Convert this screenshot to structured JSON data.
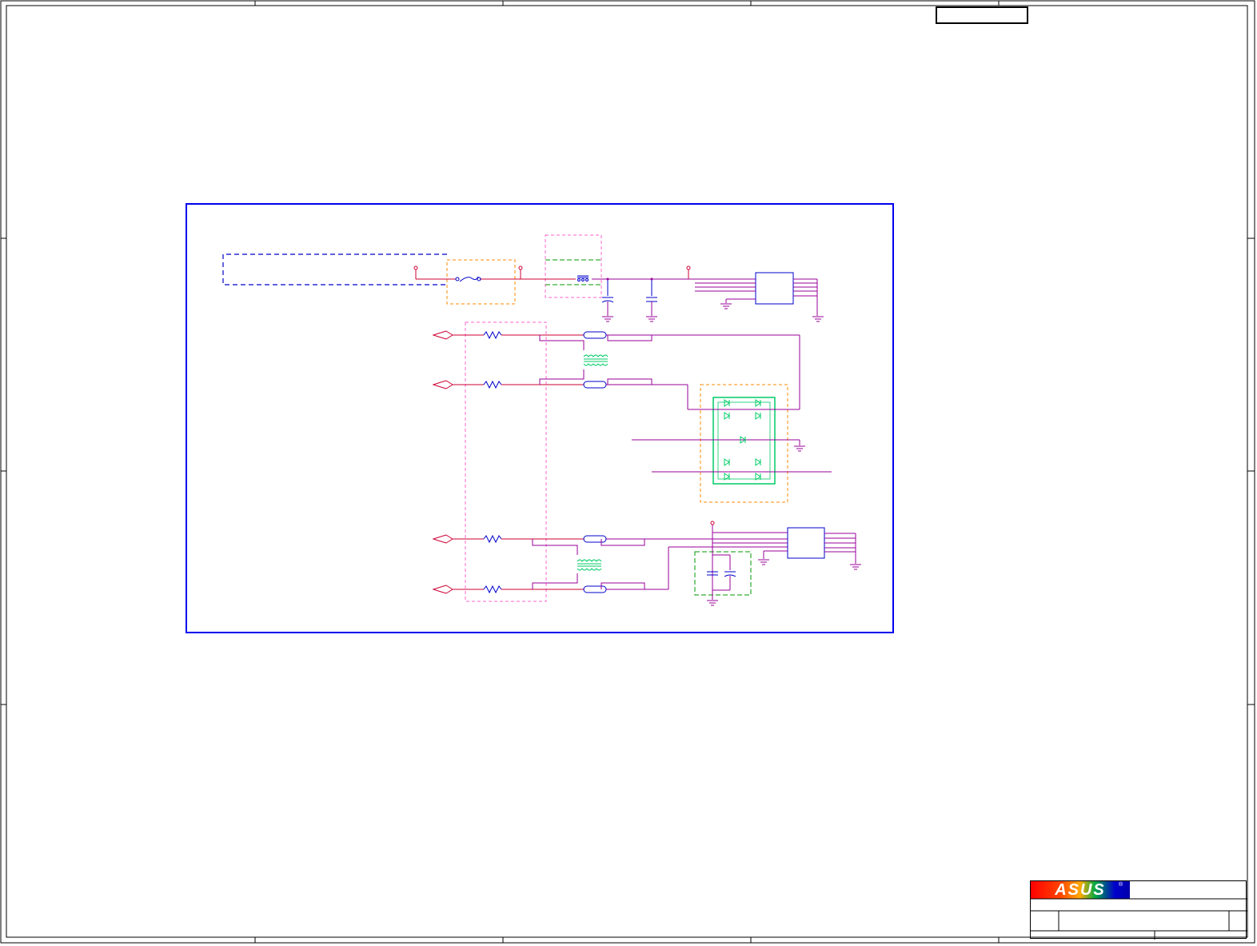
{
  "sheet": {
    "border_color": "#000000",
    "frame_color": "#0000ee"
  },
  "title_block": {
    "logo_text": "ASUS",
    "logo_icon": "asus-logo-icon",
    "registered_mark": "®"
  },
  "colors": {
    "wire": "#cc0033",
    "net": "#990099",
    "part_blue": "#0000cc",
    "part_green": "#00cc66",
    "box_orange": "#ff8800",
    "box_pink": "#ff66cc",
    "box_green": "#009900",
    "box_blue": "#0000cc"
  }
}
